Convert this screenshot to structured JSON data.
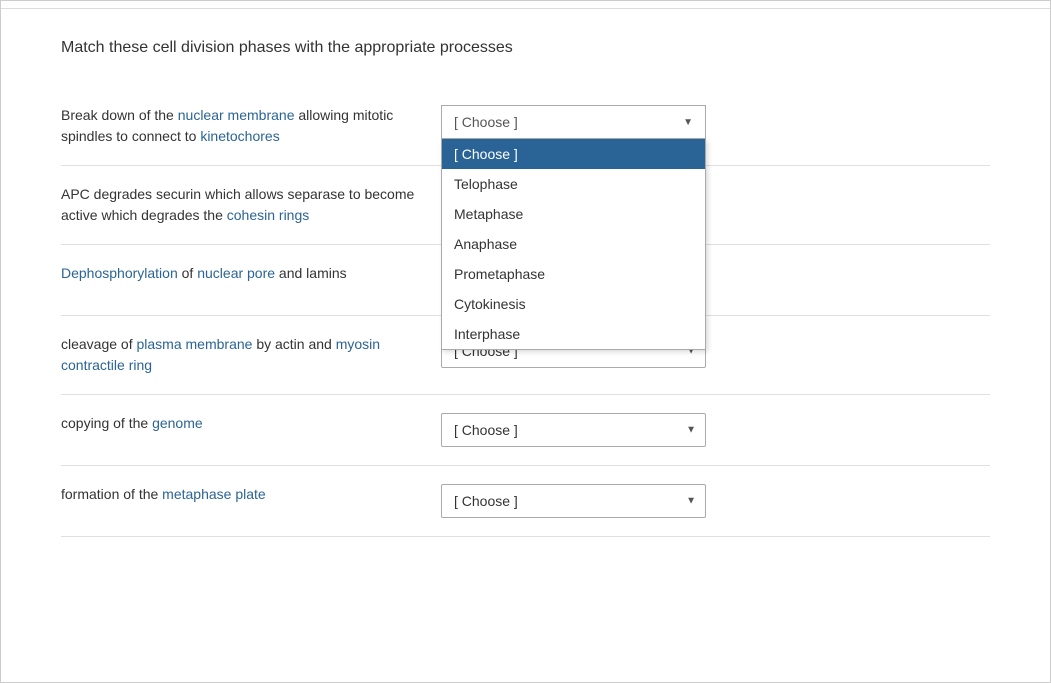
{
  "page": {
    "title": "Match these cell division phases with the appropriate processes"
  },
  "questions": [
    {
      "id": "q1",
      "text_parts": [
        {
          "text": "Break down of the ",
          "highlight": false
        },
        {
          "text": "nuclear membrane",
          "highlight": true
        },
        {
          "text": " allowing mitotic spindles to connect to ",
          "highlight": false
        },
        {
          "text": "kinetochores",
          "highlight": true
        }
      ],
      "text_display": "Break down of the nuclear membrane allowing mitotic spindles to connect to kinetochores",
      "dropdown_open": true
    },
    {
      "id": "q2",
      "text_parts": [
        {
          "text": "APC degrades securin which allows separase to become active which degrades the cohesin rings",
          "highlight": false
        }
      ],
      "text_display": "APC degrades securin which allows separase to become active which degrades the cohesin rings",
      "dropdown_open": false
    },
    {
      "id": "q3",
      "text_parts": [
        {
          "text": "Dephosphorylation of ",
          "highlight": false
        },
        {
          "text": "nuclear pore",
          "highlight": true
        },
        {
          "text": " and lamins",
          "highlight": false
        }
      ],
      "text_display": "Dephosphorylation of nuclear pore and lamins",
      "dropdown_open": false
    },
    {
      "id": "q4",
      "text_parts": [
        {
          "text": "cleavage of ",
          "highlight": false
        },
        {
          "text": "plasma membrane",
          "highlight": true
        },
        {
          "text": " by actin and ",
          "highlight": false
        },
        {
          "text": "myosin contractile ring",
          "highlight": true
        }
      ],
      "text_display": "cleavage of plasma membrane by actin and myosin contractile ring",
      "dropdown_open": false
    },
    {
      "id": "q5",
      "text_parts": [
        {
          "text": "copying of the ",
          "highlight": false
        },
        {
          "text": "genome",
          "highlight": true
        }
      ],
      "text_display": "copying of the genome",
      "dropdown_open": false
    },
    {
      "id": "q6",
      "text_parts": [
        {
          "text": "formation of the ",
          "highlight": false
        },
        {
          "text": "metaphase plate",
          "highlight": true
        }
      ],
      "text_display": "formation of the metaphase plate",
      "dropdown_open": false
    }
  ],
  "dropdown": {
    "default_label": "[ Choose ]",
    "options": [
      {
        "value": "",
        "label": "[ Choose ]",
        "selected": true
      },
      {
        "value": "telophase",
        "label": "Telophase"
      },
      {
        "value": "metaphase",
        "label": "Metaphase"
      },
      {
        "value": "anaphase",
        "label": "Anaphase"
      },
      {
        "value": "prometaphase",
        "label": "Prometaphase"
      },
      {
        "value": "cytokinesis",
        "label": "Cytokinesis"
      },
      {
        "value": "interphase",
        "label": "Interphase"
      }
    ]
  },
  "colors": {
    "highlight_text": "#2a6496",
    "selected_bg": "#2a7abd",
    "border": "#aaa",
    "text": "#333"
  }
}
